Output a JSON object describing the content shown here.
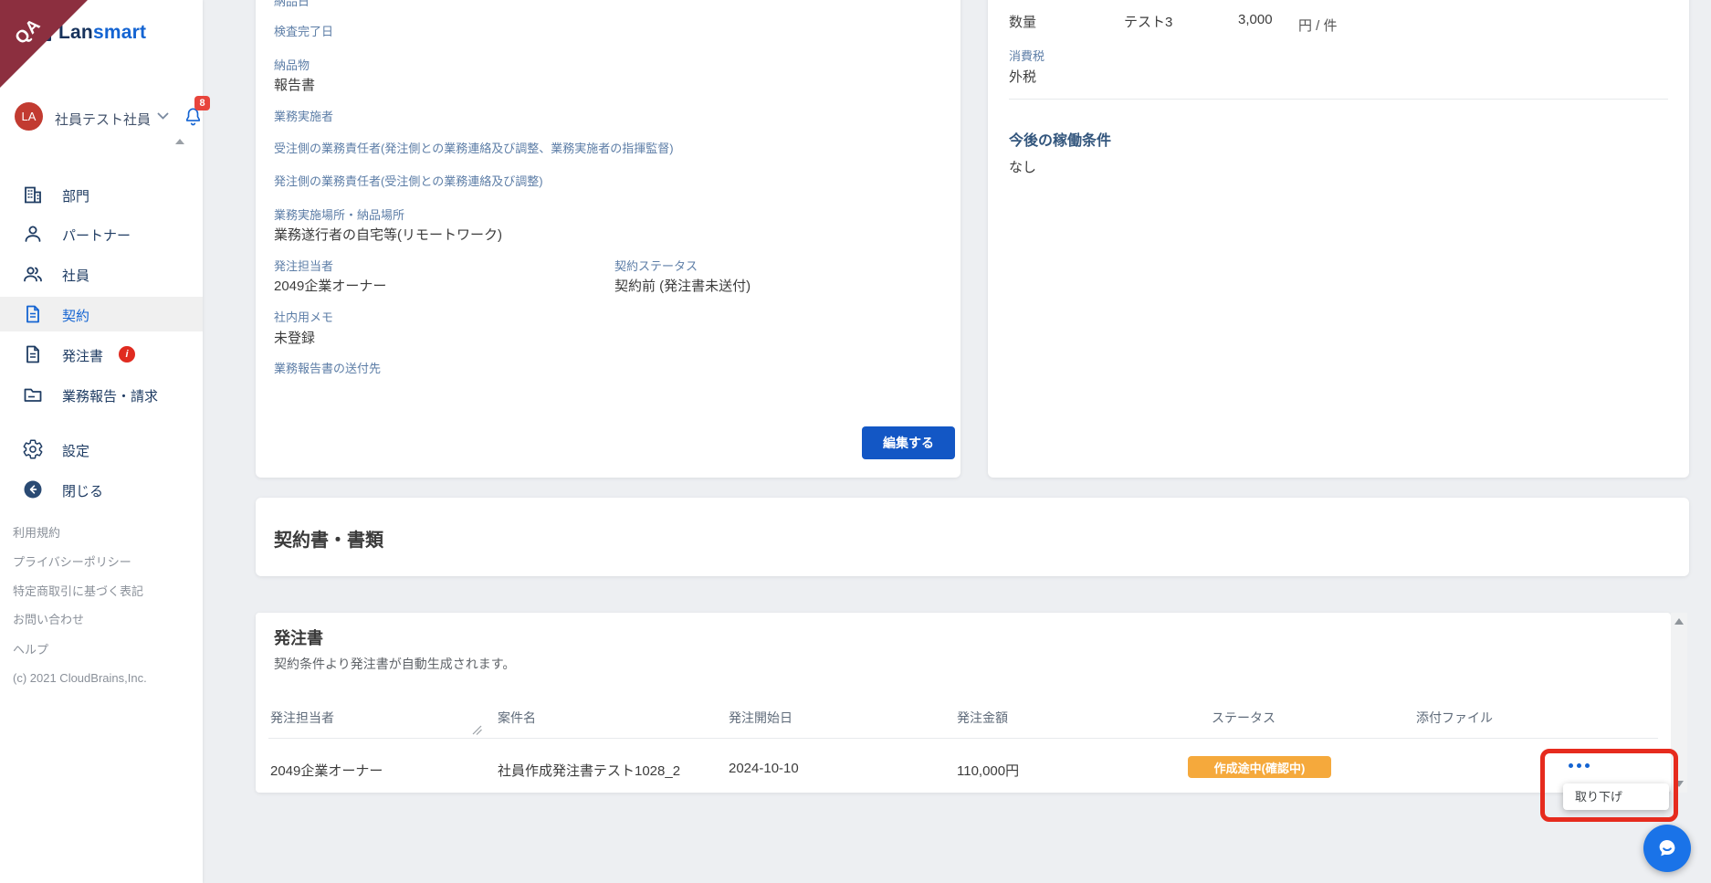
{
  "colors": {
    "accent_blue": "#1464d2",
    "button_blue": "#1357c5",
    "navy_text": "#1f3c63",
    "label_blue": "#5d7ea7",
    "badge_orange": "#f5a93c",
    "alert_red": "#e02b20",
    "highlight_red": "#e62b1e",
    "ribbon_maroon": "#8c2f3f",
    "avatar_red": "#c23b31",
    "chat_blue": "#1a73e8",
    "page_bg": "#edeff2"
  },
  "ribbon": {
    "label": "QA"
  },
  "brand": {
    "name_primary": "Lan",
    "name_secondary": "smart"
  },
  "user_bar": {
    "avatar_initials": "LA",
    "name": "社員テスト社員",
    "notification_count": "8"
  },
  "sidebar": {
    "items": [
      {
        "label": "部門",
        "icon": "building-icon"
      },
      {
        "label": "パートナー",
        "icon": "person-icon"
      },
      {
        "label": "社員",
        "icon": "people-icon"
      },
      {
        "label": "契約",
        "icon": "document-icon",
        "active": true
      },
      {
        "label": "発注書",
        "icon": "document-icon",
        "badge": "i"
      },
      {
        "label": "業務報告・請求",
        "icon": "folder-icon"
      }
    ],
    "settings_label": "設定",
    "close_label": "閉じる",
    "links": [
      "利用規約",
      "プライバシーポリシー",
      "特定商取引に基づく表記",
      "お問い合わせ",
      "ヘルプ"
    ],
    "copyright": "(c) 2021 CloudBrains,Inc."
  },
  "contract_detail": {
    "delivery_date_label": "納品日",
    "inspection_label": "検査完了日",
    "deliverable_label": "納品物",
    "deliverable_value": "報告書",
    "performer_label": "業務実施者",
    "contractor_manager_label": "受注側の業務責任者(発注側との業務連絡及び調整、業務実施者の指揮監督)",
    "orderer_manager_label": "発注側の業務責任者(受注側との業務連絡及び調整)",
    "location_label": "業務実施場所・納品場所",
    "location_value": "業務遂行者の自宅等(リモートワーク)",
    "orderer_label": "発注担当者",
    "orderer_value": "2049企業オーナー",
    "status_label": "契約ステータス",
    "status_value": "契約前 (発注書未送付)",
    "memo_label": "社内用メモ",
    "memo_value": "未登録",
    "report_dest_label": "業務報告書の送付先",
    "edit_button": "編集する"
  },
  "conditions_panel": {
    "quantity_label": "数量",
    "quantity_name": "テスト3",
    "quantity_value": "3,000",
    "quantity_unit": "円 / 件",
    "tax_label": "消費税",
    "tax_value": "外税",
    "future_heading": "今後の稼働条件",
    "future_value": "なし"
  },
  "documents_section": {
    "title": "契約書・書類"
  },
  "order_section": {
    "title": "発注書",
    "subtitle": "契約条件より発注書が自動生成されます。",
    "table": {
      "headers": [
        "発注担当者",
        "案件名",
        "発注開始日",
        "発注金額",
        "ステータス",
        "添付ファイル"
      ],
      "row": {
        "orderer": "2049企業オーナー",
        "project": "社員作成発注書テスト1028_2",
        "start_date": "2024-10-10",
        "amount": "110,000円",
        "status": "作成途中(確認中)"
      }
    },
    "menu_item": "取り下げ"
  }
}
